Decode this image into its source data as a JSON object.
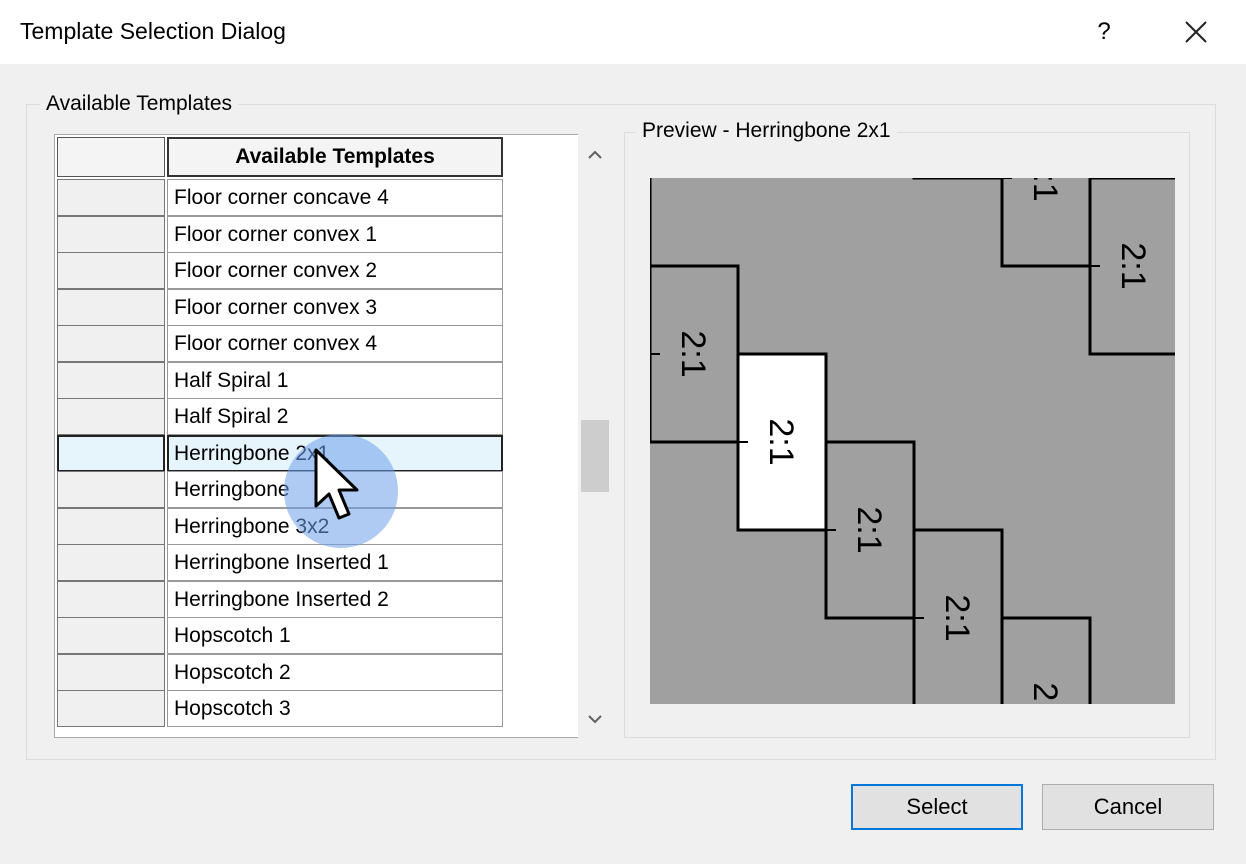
{
  "window": {
    "title": "Template Selection Dialog",
    "help_label": "?",
    "close_icon": "close-icon"
  },
  "group": {
    "label": "Available Templates"
  },
  "grid": {
    "column_header": "Available Templates",
    "selected_index": 7,
    "rows": [
      "Floor corner concave 4",
      "Floor corner convex 1",
      "Floor corner convex 2",
      "Floor corner convex 3",
      "Floor corner convex 4",
      "Half Spiral 1",
      "Half Spiral 2",
      "Herringbone 2x1",
      "Herringbone",
      "Herringbone 3x2",
      "Herringbone Inserted 1",
      "Herringbone Inserted 2",
      "Hopscotch 1",
      "Hopscotch 2",
      "Hopscotch 3"
    ]
  },
  "preview": {
    "label": "Preview - Herringbone 2x1",
    "tile_label": "2:1",
    "colors": {
      "tile": "#a0a0a0",
      "highlight": "#ffffff",
      "line": "#000000"
    }
  },
  "buttons": {
    "select": "Select",
    "cancel": "Cancel"
  },
  "colors": {
    "accent": "#0078d7",
    "selected_row": "#e6f4fb"
  }
}
